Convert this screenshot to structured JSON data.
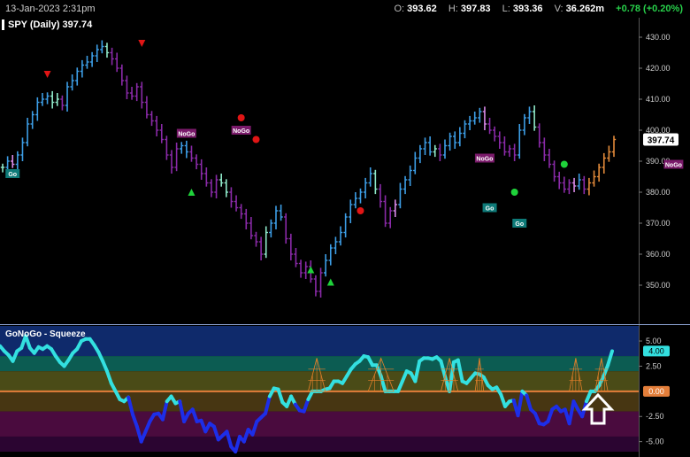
{
  "header": {
    "datetime": "13-Jan-2023 2:31pm",
    "o_label": "O:",
    "o_value": "393.62",
    "h_label": "H:",
    "h_value": "397.83",
    "l_label": "L:",
    "l_value": "393.36",
    "v_label": "V:",
    "v_value": "36.262m",
    "change": "+0.78 (+0.20%)"
  },
  "chart_data": [
    {
      "type": "bar",
      "title": "SPY (Daily) 397.74",
      "last_price": "397.74",
      "ylim": [
        342,
        434
      ],
      "yticks": [
        "430.00",
        "420.00",
        "410.00",
        "400.00",
        "390.00",
        "380.00",
        "370.00",
        "360.00",
        "350.00"
      ],
      "colors": {
        "strong_up": "#3d9ee6",
        "weak_up": "#8ee8c8",
        "weak_down": "#d98ae8",
        "strong_down": "#8a2aa8",
        "neutral": "#e38a3a"
      },
      "series": [
        {
          "values": [
            388,
            390,
            389,
            392,
            396,
            402,
            405,
            409,
            410,
            411,
            409,
            410,
            408,
            414,
            416,
            419,
            421,
            422,
            424,
            426,
            427,
            425,
            423,
            420,
            416,
            412,
            411,
            414,
            409,
            405,
            403,
            400,
            397,
            392,
            388,
            394,
            395,
            393,
            391,
            389,
            386,
            383,
            380,
            384,
            383,
            380,
            377,
            375,
            373,
            370,
            366,
            364,
            360,
            367,
            370,
            374,
            372,
            365,
            360,
            357,
            354,
            356,
            352,
            348,
            354,
            358,
            362,
            364,
            367,
            372,
            376,
            378,
            380,
            383,
            386,
            381,
            377,
            370,
            374,
            376,
            381,
            384,
            387,
            391,
            394,
            396,
            393,
            394,
            392,
            395,
            398,
            396,
            399,
            402,
            403,
            404,
            406,
            402,
            400,
            398,
            396,
            393,
            394,
            392,
            400,
            404,
            406,
            401,
            396,
            392,
            389,
            385,
            383,
            381,
            383,
            382,
            384,
            381,
            383,
            385,
            388,
            391,
            393,
            397
          ]
        }
      ],
      "signals": {
        "go": [
          {
            "x": 2,
            "y": 386
          },
          {
            "x": 98,
            "y": 375
          },
          {
            "x": 104,
            "y": 370
          }
        ],
        "nogo": [
          {
            "x": 37,
            "y": 399
          },
          {
            "x": 48,
            "y": 400
          },
          {
            "x": 97,
            "y": 391
          },
          {
            "x": 135,
            "y": 389
          }
        ],
        "go_label": "Go",
        "nogo_label": "NoGo",
        "triangle_up": [
          {
            "x": 38,
            "y": 380
          },
          {
            "x": 62,
            "y": 355
          },
          {
            "x": 66,
            "y": 351
          }
        ],
        "triangle_down": [
          {
            "x": 9,
            "y": 418
          },
          {
            "x": 28,
            "y": 428
          }
        ],
        "dot_red": [
          {
            "x": 48,
            "y": 404
          },
          {
            "x": 51,
            "y": 397
          },
          {
            "x": 72,
            "y": 374
          }
        ],
        "dot_green": [
          {
            "x": 113,
            "y": 389
          },
          {
            "x": 103,
            "y": 380
          }
        ]
      }
    },
    {
      "type": "line",
      "title": "GoNoGo - Squeeze",
      "ylim": [
        -6,
        6.5
      ],
      "yticks": [
        "5.00",
        "2.50",
        "-2.50",
        "-5.00"
      ],
      "current_value": "4.00",
      "zero_label": "0.00",
      "series": [
        {
          "values": [
            4.5,
            4.0,
            3.6,
            3.0,
            4.0,
            4.3,
            5.5,
            4.3,
            3.8,
            4.4,
            4.2,
            4.5,
            4.2,
            3.5,
            2.9,
            2.5,
            3.1,
            3.8,
            4.2,
            5.0,
            5.2,
            5.2,
            4.6,
            3.9,
            3.0,
            2.0,
            0.8,
            0.0,
            -0.8,
            -1.0,
            -0.6,
            -2.3,
            -3.5,
            -5.0,
            -4.0,
            -3.0,
            -2.3,
            -2.2,
            -2.8,
            -1.0,
            -0.5,
            -1.2,
            -1.0,
            -3.0,
            -2.2,
            -1.8,
            -3.0,
            -2.9,
            -4.0,
            -3.2,
            -3.5,
            -4.8,
            -4.4,
            -4.0,
            -5.5,
            -6.0,
            -4.5,
            -5.0,
            -3.8,
            -4.3,
            -3.0,
            -2.6,
            -2.2,
            -0.5,
            0.3,
            0.2,
            -1.1,
            -1.5,
            -0.5,
            -1.3,
            -1.9,
            -2.0,
            -0.8,
            0.0,
            0.0,
            0.0,
            0.2,
            0.3,
            1.0,
            1.0,
            0.8,
            1.5,
            2.2,
            2.7,
            3.0,
            3.5,
            3.4,
            2.6,
            2.6,
            1.5,
            0.0,
            0.0,
            0.0,
            0.0,
            1.0,
            2.0,
            1.8,
            1.0,
            3.0,
            3.3,
            3.3,
            3.2,
            3.4,
            3.0,
            1.4,
            0.0,
            2.9,
            3.1,
            1.0,
            0.8,
            1.3,
            1.8,
            1.7,
            1.4,
            0.6,
            0.2,
            0.4,
            -0.3,
            -1.5,
            -1.0,
            -0.9,
            -2.4,
            0.0,
            -0.4,
            -1.8,
            -2.2,
            -3.2,
            -3.3,
            -3.0,
            -1.8,
            -1.5,
            -2.0,
            -1.8,
            -3.2,
            -1.0,
            -1.8,
            -2.5,
            -1.0,
            0.0,
            0.0,
            0.6,
            1.5,
            2.6,
            4.0
          ]
        }
      ],
      "zones": [
        {
          "from": 3.5,
          "to": 6.5,
          "color": "#0f2a6b"
        },
        {
          "from": 2.0,
          "to": 3.5,
          "color": "#0c5c52"
        },
        {
          "from": 0.0,
          "to": 2.0,
          "color": "#4a4b17"
        },
        {
          "from": -2.0,
          "to": 0.0,
          "color": "#473612"
        },
        {
          "from": -4.5,
          "to": -2.0,
          "color": "#4a0b3e"
        },
        {
          "from": -6.0,
          "to": -4.5,
          "color": "#2b0531"
        }
      ],
      "colors": {
        "line_light": "#33e0e0",
        "line_dark": "#1d2ee8",
        "zero_line": "#e37e3a",
        "squeeze": "#e6802a",
        "arrow": "#ffffff"
      }
    }
  ]
}
